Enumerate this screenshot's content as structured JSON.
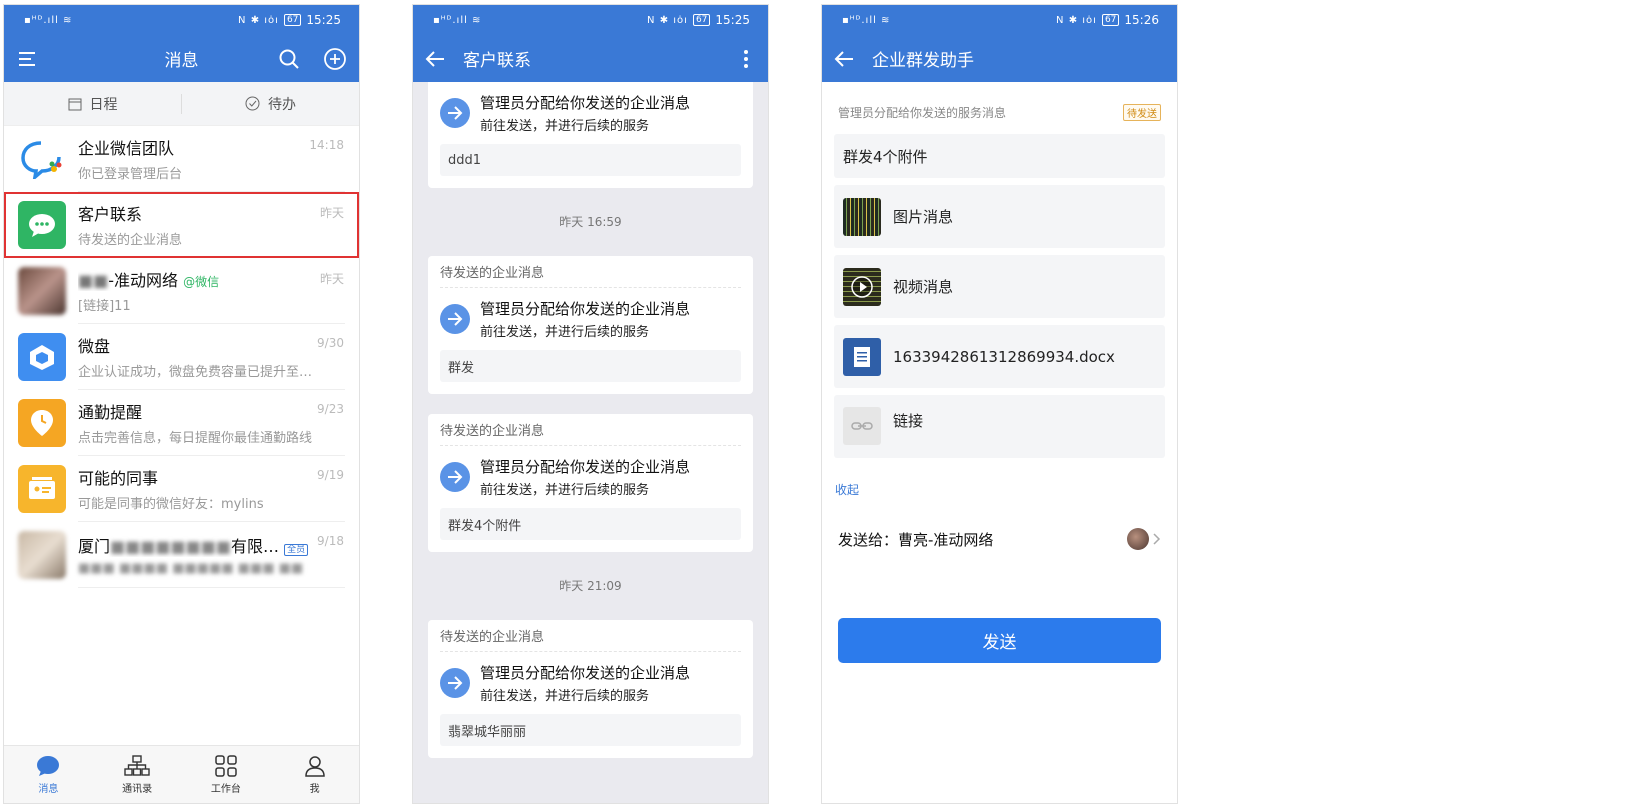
{
  "p1": {
    "status": {
      "time": "15:25",
      "battery": "67"
    },
    "title": "消息",
    "tabs": [
      "日程",
      "待办"
    ],
    "convs": [
      {
        "name": "企业微信团队",
        "sub": "你已登录管理后台",
        "time": "14:18"
      },
      {
        "name": "客户联系",
        "sub": "待发送的企业消息",
        "time": "昨天"
      },
      {
        "name": "-准动网络",
        "tag": "@微信",
        "sub": "[链接]11",
        "time": "昨天"
      },
      {
        "name": "微盘",
        "sub": "企业认证成功，微盘免费容量已提升至…",
        "time": "9/30"
      },
      {
        "name": "通勤提醒",
        "sub": "点击完善信息，每日提醒你最佳通勤路线",
        "time": "9/23"
      },
      {
        "name": "可能的同事",
        "sub": "可能是同事的微信好友：mylins",
        "time": "9/19"
      },
      {
        "name": "厦门",
        "name2": "有限…",
        "tag": "全员",
        "sub": "",
        "time": "9/18"
      }
    ],
    "bottom": [
      "消息",
      "通讯录",
      "工作台",
      "我"
    ]
  },
  "p2": {
    "status": {
      "time": "15:25",
      "battery": "67"
    },
    "title": "客户联系",
    "stamps": [
      "昨天 16:59",
      "昨天 21:09"
    ],
    "card_header": "待发送的企业消息",
    "msg_line1": "管理员分配给你发送的企业消息",
    "msg_line2": "前往发送，并进行后续的服务",
    "boxes": [
      "ddd1",
      "群发",
      "群发4个附件",
      "翡翠城华丽丽"
    ]
  },
  "p3": {
    "status": {
      "time": "15:26",
      "battery": "67"
    },
    "title": "企业群发助手",
    "meta": "管理员分配给你发送的服务消息",
    "badge": "待发送",
    "text": "群发4个附件",
    "items": [
      "图片消息",
      "视频消息",
      "1633942861312869934.docx",
      "链接"
    ],
    "fold": "收起",
    "send_to_label": "发送给：",
    "send_to_name": "曹亮-准动网络",
    "send_button": "发送"
  },
  "colors": {
    "brand": "#3a79d6",
    "button": "#2c7bec",
    "highlight": "#e03333"
  }
}
